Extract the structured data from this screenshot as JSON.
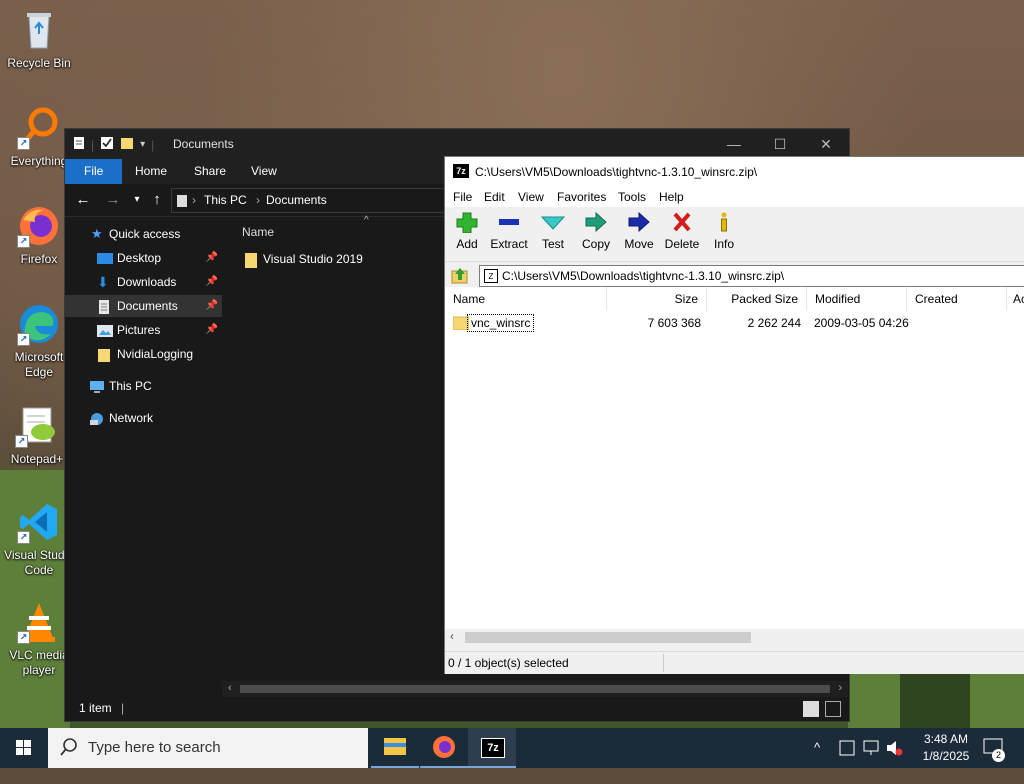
{
  "desktop": {
    "icons": [
      {
        "label": "Recycle Bin"
      },
      {
        "label": "Everything"
      },
      {
        "label": "Firefox"
      },
      {
        "label": "Microsoft Edge"
      },
      {
        "label": "Notepad+"
      },
      {
        "label": "Visual Studio Code"
      },
      {
        "label": "VLC media player"
      }
    ]
  },
  "explorer": {
    "title": "Documents",
    "tabs": [
      "File",
      "Home",
      "Share",
      "View"
    ],
    "breadcrumb": [
      "This PC",
      "Documents"
    ],
    "nav": {
      "quick_access": "Quick access",
      "items": [
        "Desktop",
        "Downloads",
        "Documents",
        "Pictures",
        "NvidiaLogging"
      ],
      "this_pc": "This PC",
      "network": "Network"
    },
    "column_name": "Name",
    "files": [
      "Visual Studio 2019"
    ],
    "status": "1 item"
  },
  "sevenzip": {
    "title": "C:\\Users\\VM5\\Downloads\\tightvnc-1.3.10_winsrc.zip\\",
    "menu": [
      "File",
      "Edit",
      "View",
      "Favorites",
      "Tools",
      "Help"
    ],
    "toolbar": [
      "Add",
      "Extract",
      "Test",
      "Copy",
      "Move",
      "Delete",
      "Info"
    ],
    "address": "C:\\Users\\VM5\\Downloads\\tightvnc-1.3.10_winsrc.zip\\",
    "columns": [
      "Name",
      "Size",
      "Packed Size",
      "Modified",
      "Created",
      "Ac"
    ],
    "rows": [
      {
        "name": "vnc_winsrc",
        "size": "7 603 368",
        "packed": "2 262 244",
        "modified": "2009-03-05 04:26",
        "created": ""
      }
    ],
    "status": "0 / 1 object(s) selected"
  },
  "taskbar": {
    "search_placeholder": "Type here to search",
    "time": "3:48 AM",
    "date": "1/8/2025",
    "notification_count": "2"
  }
}
